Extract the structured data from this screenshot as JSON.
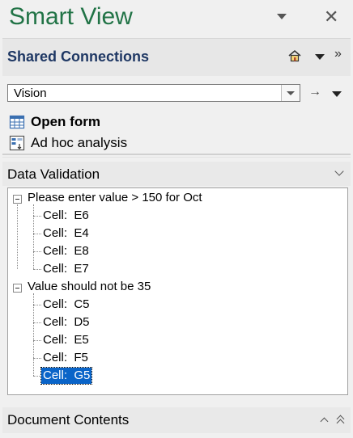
{
  "pane": {
    "title": "Smart View",
    "close_glyph": "✕"
  },
  "shared": {
    "title": "Shared Connections",
    "more_glyph": "»"
  },
  "connection": {
    "value": "Vision",
    "go_glyph": "→"
  },
  "actions": {
    "open_form": "Open form",
    "ad_hoc": "Ad hoc analysis"
  },
  "data_validation": {
    "title": "Data Validation",
    "groups": [
      {
        "label": "Please enter value > 150 for Oct",
        "cells": [
          "Cell:  E6",
          "Cell:  E4",
          "Cell:  E8",
          "Cell:  E7"
        ]
      },
      {
        "label": "Value should not be 35",
        "cells": [
          "Cell:  C5",
          "Cell:  D5",
          "Cell:  E5",
          "Cell:  F5",
          "Cell:  G5"
        ]
      }
    ],
    "selected": "Cell:  G5"
  },
  "document_contents": {
    "title": "Document Contents"
  },
  "colors": {
    "title_green": "#217346",
    "header_blue": "#1f3864",
    "selection": "#0a64c8"
  },
  "icons": [
    "dropdown-arrow-icon",
    "close-icon",
    "home-icon",
    "more-icon",
    "go-arrow-icon",
    "form-grid-icon",
    "ad-hoc-icon",
    "chevron-down-icon",
    "collapse-icon",
    "chevron-up-icon",
    "double-chevron-up-icon"
  ]
}
